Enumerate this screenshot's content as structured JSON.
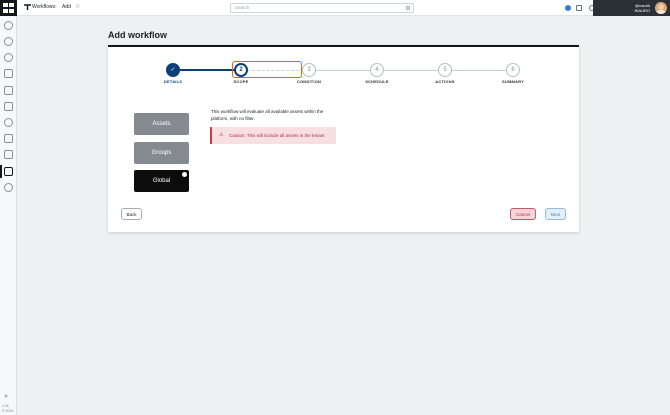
{
  "topbar": {
    "crumb_section": "Workflows",
    "crumb_current": "Add",
    "search_placeholder": "Search",
    "user_name_line1": "@naurik",
    "user_name_line2": "INAURO"
  },
  "rail": {
    "version_line1": "v 24",
    "version_line2": "© 2024"
  },
  "page": {
    "title": "Add workflow"
  },
  "stepper": {
    "steps": [
      {
        "number": "✓",
        "label": "DETAILS",
        "state": "done"
      },
      {
        "number": "2",
        "label": "SCOPE",
        "state": "current"
      },
      {
        "number": "3",
        "label": "CONDITION",
        "state": "upcoming"
      },
      {
        "number": "4",
        "label": "SCHEDULE",
        "state": "upcoming"
      },
      {
        "number": "5",
        "label": "ACTIONS",
        "state": "upcoming"
      },
      {
        "number": "6",
        "label": "SUMMARY",
        "state": "upcoming"
      }
    ]
  },
  "scope": {
    "options": [
      "Assets",
      "Groups",
      "Global"
    ],
    "selected": "Global",
    "description": "This workflow will evaluate all available assets within the platform, with no filter.",
    "caution": "Caution: This will include all assets in the tenant"
  },
  "actions": {
    "back": "Back",
    "cancel": "Cancel",
    "next": "Next"
  },
  "colors": {
    "accent": "#0b3f7a",
    "highlight": "#e8631c",
    "danger": "#d23b4a",
    "selected_tile": "#0c0c0c"
  }
}
